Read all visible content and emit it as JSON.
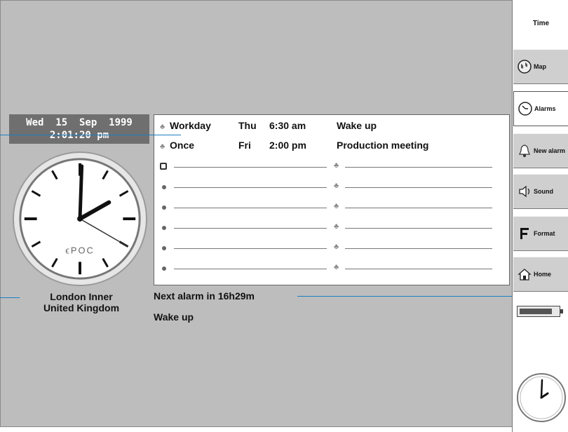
{
  "clock": {
    "date": "Wed  15  Sep  1999",
    "time": "2:01:20 pm",
    "brand": "ϵPOC",
    "hour": 2,
    "minute": 1,
    "second": 20,
    "location_line1": "London Inner",
    "location_line2": "United Kingdom"
  },
  "alarms": [
    {
      "repeat": "Workday",
      "day": "Thu",
      "time": "6:30 am",
      "description": "Wake up"
    },
    {
      "repeat": "Once",
      "day": "Fri",
      "time": "2:00 pm",
      "description": "Production meeting"
    }
  ],
  "empty_alarm_slots": 6,
  "status": {
    "next_alarm": "Next alarm in 16h29m",
    "next_alarm_description": "Wake up"
  },
  "sidebar": {
    "tab_label": "Time",
    "buttons": [
      {
        "label": "Map",
        "icon": "globe-icon"
      },
      {
        "label": "Alarms",
        "icon": "alarm-clock-icon"
      },
      {
        "label": "New alarm",
        "icon": "bell-icon"
      },
      {
        "label": "Sound",
        "icon": "speaker-icon"
      },
      {
        "label": "Format",
        "icon": "format-f-icon"
      },
      {
        "label": "Home",
        "icon": "home-icon"
      }
    ],
    "battery_level": 0.85
  },
  "colors": {
    "screen": "#bdbdbd",
    "date_bar": "#6f6f6f",
    "callout": "#1a7fc1"
  }
}
